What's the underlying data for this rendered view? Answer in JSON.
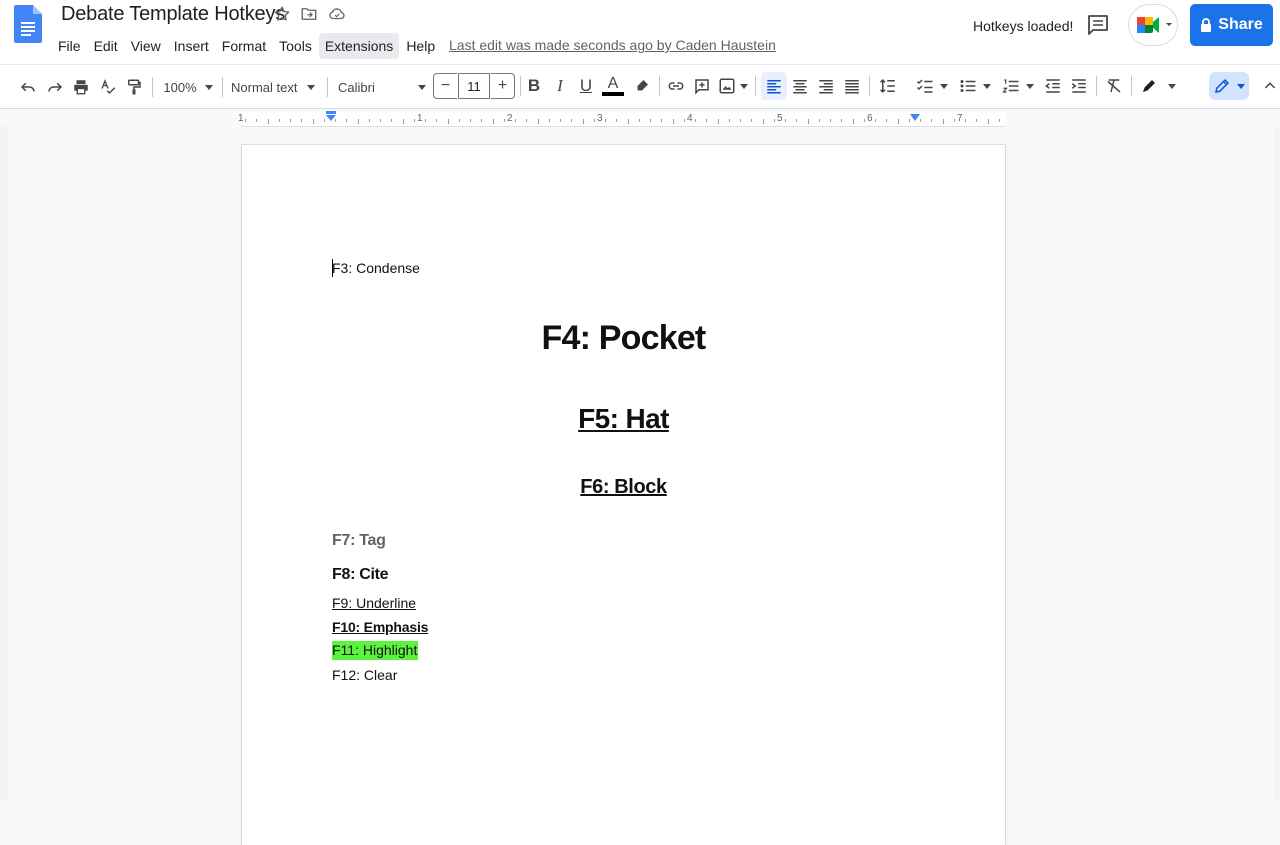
{
  "header": {
    "doc_title": "Debate Template Hotkeys",
    "menus": [
      "File",
      "Edit",
      "View",
      "Insert",
      "Format",
      "Tools",
      "Extensions",
      "Help"
    ],
    "active_menu": "Extensions",
    "last_edit": "Last edit was made seconds ago by Caden Haustein",
    "status": "Hotkeys loaded!",
    "share_label": "Share",
    "accent": "#1a73e8"
  },
  "toolbar": {
    "zoom": "100%",
    "style": "Normal text",
    "font": "Calibri",
    "font_size": "11",
    "minus": "−",
    "plus": "+"
  },
  "ruler": {
    "numbers": [
      "1",
      "1",
      "2",
      "3",
      "4",
      "5",
      "6",
      "7"
    ]
  },
  "document": {
    "lines": [
      {
        "text": "F3: Condense"
      },
      {
        "text": "F4: Pocket"
      },
      {
        "text": "F5: Hat"
      },
      {
        "text": "F6: Block"
      },
      {
        "text": "F7: Tag"
      },
      {
        "text": "F8: Cite"
      },
      {
        "text": "F9: Underline"
      },
      {
        "text": "F10: Emphasis"
      },
      {
        "text": "F11: Highlight"
      },
      {
        "text": "F12: Clear"
      }
    ],
    "highlight_color": "#5cf23e"
  }
}
